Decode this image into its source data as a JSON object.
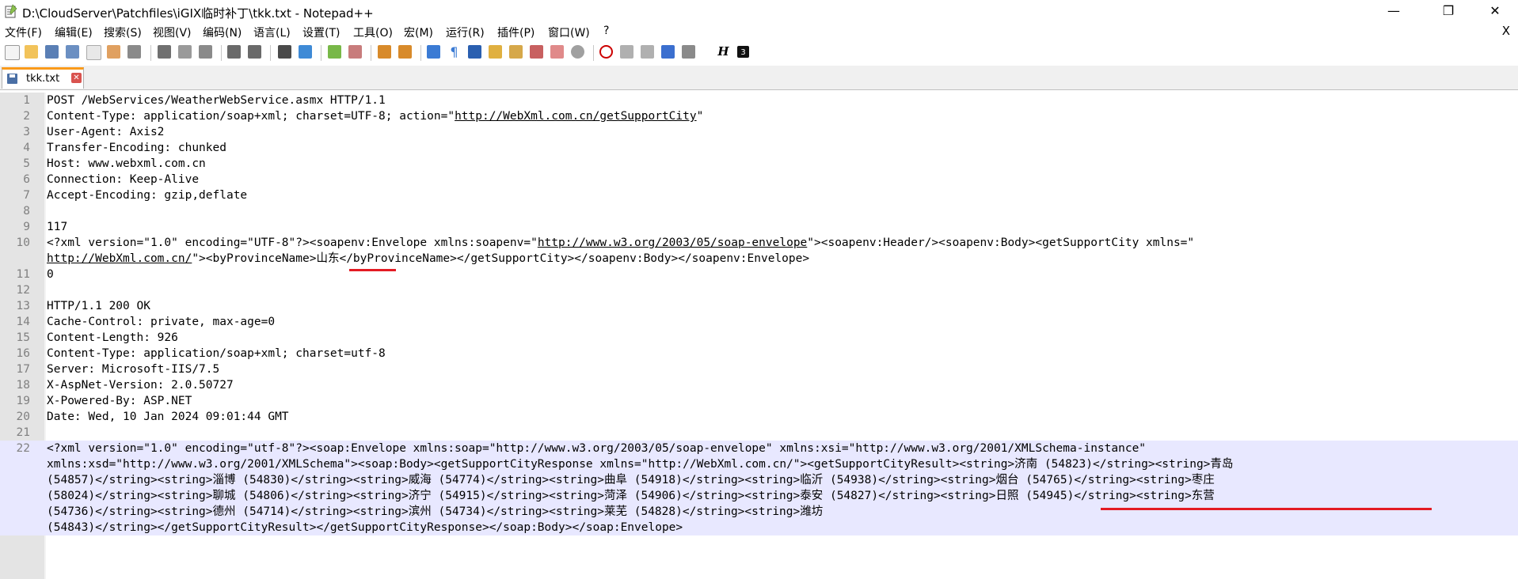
{
  "window": {
    "title": "D:\\CloudServer\\Patchfiles\\iGIX临时补丁\\tkk.txt - Notepad++",
    "min_label": "—",
    "max_label": "❐",
    "close_label": "✕"
  },
  "menu": {
    "items": [
      "文件(F)",
      "编辑(E)",
      "搜索(S)",
      "视图(V)",
      "编码(N)",
      "语言(L)",
      "设置(T)",
      "工具(O)",
      "宏(M)",
      "运行(R)",
      "插件(P)",
      "窗口(W)",
      "?"
    ],
    "close_label": "X"
  },
  "toolbar": {
    "icons": [
      "new-file-icon",
      "open-file-icon",
      "save-icon",
      "save-all-icon",
      "close-icon",
      "close-all-icon",
      "print-icon",
      "cut-icon",
      "copy-icon",
      "paste-icon",
      "undo-icon",
      "redo-icon",
      "find-icon",
      "replace-icon",
      "zoom-in-icon",
      "zoom-out-icon",
      "sync-v-icon",
      "sync-h-icon",
      "word-wrap-icon",
      "show-all-chars-icon",
      "indent-guide-icon",
      "doc-map-icon",
      "function-list-icon",
      "folder-workspace-icon",
      "monitoring-icon",
      "record-macro-icon",
      "stop-macro-icon",
      "play-macro-icon",
      "run-macro-multiple-icon",
      "save-macro-icon",
      "text-direction-icon",
      "cmd-icon"
    ]
  },
  "tab": {
    "label": "tkk.txt",
    "close_label": "✕"
  },
  "editor": {
    "lines": [
      {
        "num": "1",
        "text": "POST /WebServices/WeatherWebService.asmx HTTP/1.1"
      },
      {
        "num": "2",
        "pre": "Content-Type: application/soap+xml; charset=UTF-8; action=\"",
        "link": "http://WebXml.com.cn/getSupportCity",
        "post": "\""
      },
      {
        "num": "3",
        "text": "User-Agent: Axis2"
      },
      {
        "num": "4",
        "text": "Transfer-Encoding: chunked"
      },
      {
        "num": "5",
        "text": "Host: www.webxml.com.cn"
      },
      {
        "num": "6",
        "text": "Connection: Keep-Alive"
      },
      {
        "num": "7",
        "text": "Accept-Encoding: gzip,deflate"
      },
      {
        "num": "8",
        "text": ""
      },
      {
        "num": "9",
        "text": "117"
      },
      {
        "num": "10",
        "pre": "<?xml version=\"1.0\" encoding=\"UTF-8\"?><soapenv:Envelope xmlns:soapenv=\"",
        "link": "http://www.w3.org/2003/05/soap-envelope",
        "post": "\"><soapenv:Header/><soapenv:Body><getSupportCity xmlns=\""
      },
      {
        "num": "",
        "pre": "",
        "link": "http://WebXml.com.cn/",
        "post": "\"><byProvinceName>山东</byProvinceName></getSupportCity></soapenv:Body></soapenv:Envelope>"
      },
      {
        "num": "11",
        "text": "0"
      },
      {
        "num": "12",
        "text": ""
      },
      {
        "num": "13",
        "text": "HTTP/1.1 200 OK"
      },
      {
        "num": "14",
        "text": "Cache-Control: private, max-age=0"
      },
      {
        "num": "15",
        "text": "Content-Length: 926"
      },
      {
        "num": "16",
        "text": "Content-Type: application/soap+xml; charset=utf-8"
      },
      {
        "num": "17",
        "text": "Server: Microsoft-IIS/7.5"
      },
      {
        "num": "18",
        "text": "X-AspNet-Version: 2.0.50727"
      },
      {
        "num": "19",
        "text": "X-Powered-By: ASP.NET"
      },
      {
        "num": "20",
        "text": "Date: Wed, 10 Jan 2024 09:01:44 GMT"
      },
      {
        "num": "21",
        "text": ""
      },
      {
        "num": "22",
        "text": "<?xml version=\"1.0\" encoding=\"utf-8\"?><soap:Envelope xmlns:soap=\"http://www.w3.org/2003/05/soap-envelope\" xmlns:xsi=\"http://www.w3.org/2001/XMLSchema-instance\"",
        "sel": true
      },
      {
        "num": "",
        "text": "xmlns:xsd=\"http://www.w3.org/2001/XMLSchema\"><soap:Body><getSupportCityResponse xmlns=\"http://WebXml.com.cn/\"><getSupportCityResult><string>济南 (54823)</string><string>青岛",
        "sel": true
      },
      {
        "num": "",
        "text": "(54857)</string><string>淄博 (54830)</string><string>威海 (54774)</string><string>曲阜 (54918)</string><string>临沂 (54938)</string><string>烟台 (54765)</string><string>枣庄",
        "sel": true
      },
      {
        "num": "",
        "text": "(58024)</string><string>聊城 (54806)</string><string>济宁 (54915)</string><string>菏泽 (54906)</string><string>泰安 (54827)</string><string>日照 (54945)</string><string>东营",
        "sel": true
      },
      {
        "num": "",
        "text": "(54736)</string><string>德州 (54714)</string><string>滨州 (54734)</string><string>莱芜 (54828)</string><string>潍坊",
        "sel": true
      },
      {
        "num": "",
        "text": "(54843)</string></getSupportCityResult></getSupportCityResponse></soap:Body></soap:Envelope>",
        "sel": true
      }
    ]
  },
  "colors": {
    "accent_tab": "#fa9a1a",
    "annotation_red": "#e31b23",
    "selection": "#e8e8ff",
    "gutter": "#e4e4e4"
  }
}
